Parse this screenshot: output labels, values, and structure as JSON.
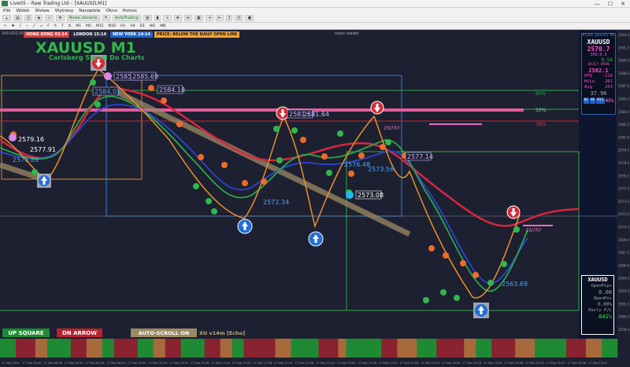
{
  "window": {
    "title": "Live05 – Raw Trading Ltd – [XAUUSD,M1]",
    "minimize": "—",
    "maximize": "☐",
    "close": "✕"
  },
  "menu": [
    "Plik",
    "Widok",
    "Wstaw",
    "Wykresy",
    "Narzędzie",
    "Okno",
    "Pomoc"
  ],
  "toolbar": {
    "new_order": "Nowe zlecenie",
    "autotrading": "AutoTrading",
    "timeframes": [
      "M1",
      "M5",
      "M15",
      "M30",
      "H1",
      "H4",
      "D1",
      "W1",
      "MN"
    ]
  },
  "chart": {
    "symbol_tab": "XAUUSD,M1",
    "sessions": [
      {
        "label": "HONG KONG 02:14",
        "color": "#d33d3d"
      },
      {
        "label": "LONDON 15:14",
        "color": "#2b2f45"
      },
      {
        "label": "NEW YORK 14:14",
        "color": "#1f63c9"
      }
    ],
    "price_alert": "PRICE: BELOW THE DAILY OPEN LINE",
    "title": "XAUUSD M1",
    "subtitle": "Carlsberg Signal Do Charts",
    "news_label": "news reader",
    "price_labels": [
      {
        "text": "2585.69",
        "color": "#cbb1ff"
      },
      {
        "text": "2584.01",
        "color": "#cbb1ff"
      },
      {
        "text": "2584.18",
        "color": "#cbb1ff"
      },
      {
        "text": "2579.16",
        "color": "#ffffff"
      },
      {
        "text": "2577.91",
        "color": "#ffffff"
      },
      {
        "text": "2576.89",
        "color": "#4aa3ff"
      },
      {
        "text": "2581.63",
        "color": "#cbb1ff"
      },
      {
        "text": "2581.64",
        "color": "#cbb1ff"
      },
      {
        "text": "2576.48",
        "color": "#4aa3ff"
      },
      {
        "text": "2577.14",
        "color": "#cbb1ff"
      },
      {
        "text": "2572.34",
        "color": "#4aa3ff"
      },
      {
        "text": "2573.56",
        "color": "#4aa3ff"
      },
      {
        "text": "2573.08",
        "color": "#ffffff"
      },
      {
        "text": "2563.69",
        "color": "#4aa3ff"
      }
    ],
    "entry_labels": [
      "ENTRY",
      "ENTRY"
    ],
    "pct_labels": [
      "80%",
      "50%",
      "38%"
    ],
    "axis_prices": [
      "2593.0",
      "2591.5",
      "2590.0",
      "2588.5",
      "2587.0",
      "2585.5",
      "2584.0",
      "2582.5",
      "2581.0",
      "2579.5",
      "2578.0",
      "2576.5",
      "2575.0",
      "2573.5",
      "2572.0",
      "2570.5",
      "2569.0",
      "2567.5",
      "2566.0",
      "2564.5",
      "2563.0",
      "2561.5",
      "2560.0",
      "2558.5"
    ],
    "time_labels": [
      "17 Sep 2024",
      "17 Sep 08:40",
      "17 Sep 08:56",
      "17 Sep 09:12",
      "17 Sep 09:28",
      "17 Sep 09:44",
      "17 Sep 10:00",
      "17 Sep 10:16",
      "17 Sep 10:32",
      "17 Sep 10:48",
      "17 Sep 11:04",
      "17 Sep 11:20",
      "17 Sep 11:36",
      "17 Sep 11:52",
      "17 Sep 12:08",
      "17 Sep 12:24",
      "17 Sep 12:40",
      "17 Sep 12:56",
      "17 Sep 13:12",
      "17 Sep 13:28",
      "17 Sep 13:44",
      "17 Sep 14:00",
      "17 Sep 14:16",
      "17 Sep 14:32",
      "17 Sep 14:48",
      "17 Sep 15:04",
      "17 Sep 15:20",
      "17 Sep 15:36",
      "17 Sep 15:52"
    ]
  },
  "info_panel": {
    "header": "Pivot points M1",
    "symbol": "XAUUSD",
    "price": "2570.7",
    "spread": "SPD:0.5",
    "timer": "0:56",
    "daily_open_label": "DAILY OPEN",
    "daily_open": "2582.1",
    "pfo_label": "PFO",
    "pfo": "-114",
    "hilo_label": "HiLo",
    "hilo": "261",
    "avg_label": "Avg",
    "avg": "253",
    "atr": "37.96",
    "tf_buttons": [
      "M1",
      "M5",
      "M15"
    ],
    "percent": "45%"
  },
  "pnl_panel": {
    "symbol": "XAUUSD",
    "open_pips_label": "OpenPips",
    "open_pips": "0.00",
    "open_pos_label": "OpenPos",
    "open_pos": "0.00%",
    "daily_pl_label": "Daily P/L",
    "daily_pl": "641%"
  },
  "bottom_buttons": {
    "up_square": "UP SQUARE",
    "dn_arrow": "DN ARROW",
    "auto_scroll": "AUTO-SCROLL ON",
    "version": "XU v14m [Echo]"
  }
}
